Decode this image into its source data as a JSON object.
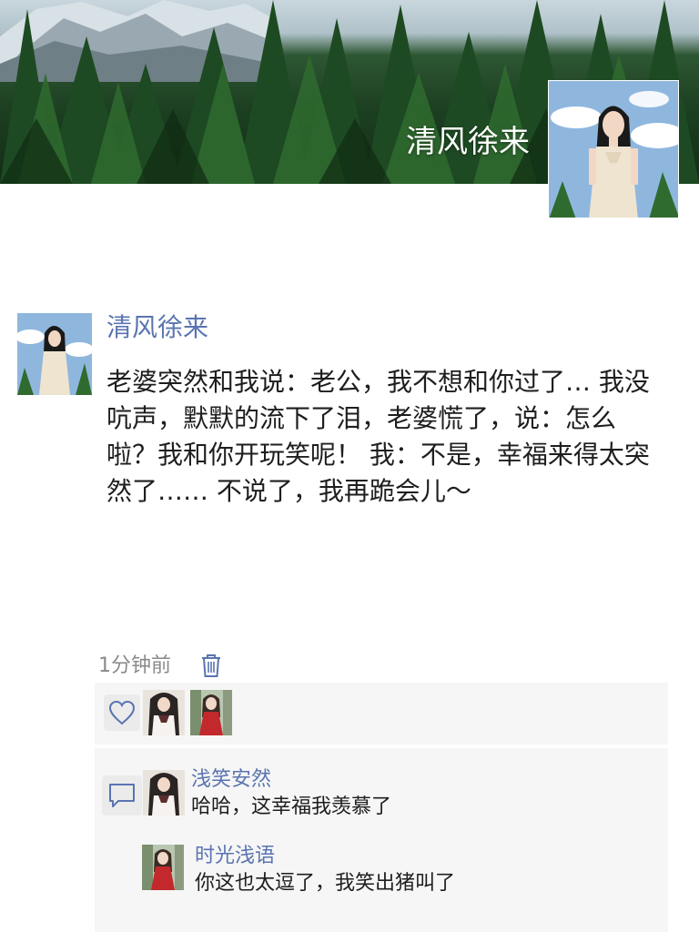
{
  "cover": {
    "username": "清风徐来",
    "avatar_icon": "profile-avatar"
  },
  "post": {
    "author": "清风徐来",
    "text": "老婆突然和我说：老公，我不想和你过了… 我没吭声，默默的流下了泪，老婆慌了，说：怎么啦？我和你开玩笑呢！ 我：不是，幸福来得太突然了…… 不说了，我再跪会儿～",
    "time": "1分钟前",
    "delete_icon": "trash-icon"
  },
  "likes": {
    "icon": "heart-icon",
    "avatars": [
      "liker-avatar-1",
      "liker-avatar-2"
    ]
  },
  "comments": {
    "icon": "comment-icon",
    "items": [
      {
        "name": "浅笑安然",
        "text": "哈哈，这幸福我羡慕了"
      },
      {
        "name": "时光浅语",
        "text": "你这也太逗了，我笑出猪叫了"
      }
    ]
  },
  "colors": {
    "link_blue": "#5a74b0",
    "panel_bg": "#f6f6f6",
    "text": "#1e1e1e",
    "muted": "#8a8a8a"
  }
}
